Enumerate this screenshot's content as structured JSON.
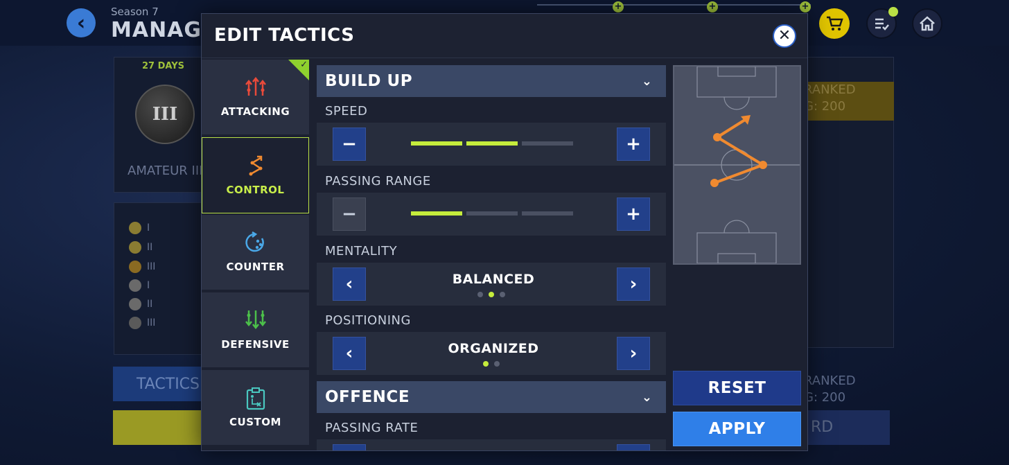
{
  "background": {
    "season": "Season 7",
    "screen_title": "MANAGER",
    "days": "27 DAYS",
    "league_badge": "III",
    "league_name": "AMATEUR III",
    "rank_rows": [
      "I",
      "II",
      "III",
      "I",
      "II",
      "III"
    ],
    "tactics_button": "TACTICS",
    "ranked_top": [
      "RANKED",
      "G: 200"
    ],
    "ranked_bottom": [
      "RANKED",
      "G: 200"
    ],
    "bottom_right_button": "RD",
    "icons": {
      "back": "back-arrow-icon",
      "cart": "cart-icon",
      "list": "checklist-icon",
      "home": "home-icon"
    }
  },
  "modal": {
    "title": "EDIT TACTICS",
    "close_icon": "close-icon",
    "tabs": [
      {
        "label": "ATTACKING",
        "icon": "attacking-arrows-icon",
        "selected_check": true
      },
      {
        "label": "CONTROL",
        "icon": "control-path-icon",
        "active": true
      },
      {
        "label": "COUNTER",
        "icon": "counter-rotate-icon"
      },
      {
        "label": "DEFENSIVE",
        "icon": "defensive-arrows-icon"
      },
      {
        "label": "CUSTOM",
        "icon": "custom-clipboard-icon"
      }
    ],
    "sections": {
      "build_up": {
        "title": "BUILD UP",
        "speed": {
          "label": "SPEED",
          "level": 2,
          "max": 3
        },
        "passing_range": {
          "label": "PASSING RANGE",
          "level": 1,
          "max": 3
        },
        "mentality": {
          "label": "MENTALITY",
          "value": "BALANCED",
          "index": 2,
          "count": 3
        },
        "positioning": {
          "label": "POSITIONING",
          "value": "ORGANIZED",
          "index": 1,
          "count": 2
        }
      },
      "offence": {
        "title": "OFFENCE",
        "passing_rate": {
          "label": "PASSING RATE"
        }
      }
    },
    "buttons": {
      "reset": "RESET",
      "apply": "APPLY"
    },
    "colors": {
      "accent_green": "#c5ec3c",
      "orange_path": "#f08a30",
      "button_blue": "#22408a",
      "apply_blue": "#2f7fe8"
    }
  }
}
